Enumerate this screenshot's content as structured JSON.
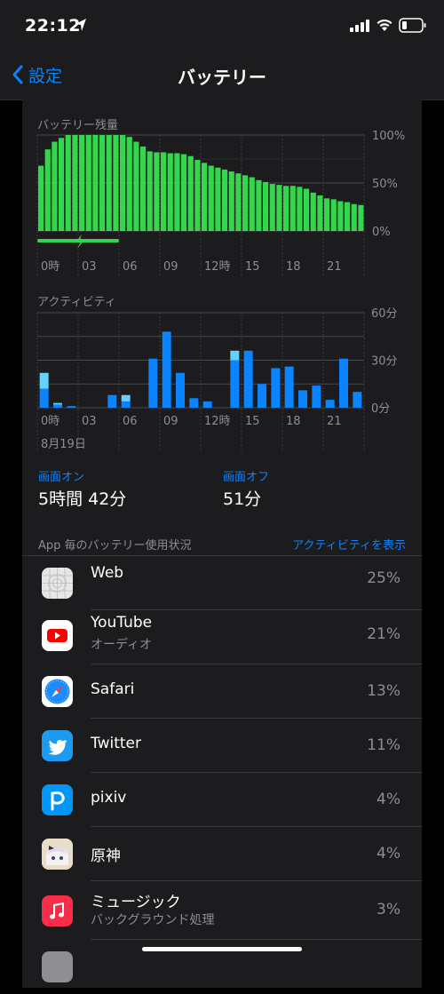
{
  "status": {
    "time": "22:12"
  },
  "nav": {
    "back_label": "設定",
    "title": "バッテリー"
  },
  "battery_chart": {
    "label": "バッテリー残量",
    "y_ticks": [
      "100%",
      "50%",
      "0%"
    ],
    "x_ticks": [
      "0時",
      "03",
      "06",
      "09",
      "12時",
      "15",
      "18",
      "21"
    ]
  },
  "activity_chart": {
    "label": "アクティビティ",
    "y_ticks": [
      "60分",
      "30分",
      "0分"
    ],
    "x_ticks": [
      "0時",
      "03",
      "06",
      "09",
      "12時",
      "15",
      "18",
      "21"
    ],
    "date_label": "8月19日"
  },
  "chart_data": [
    {
      "type": "area",
      "title": "バッテリー残量",
      "ylim": [
        0,
        100
      ],
      "x_unit": "hour",
      "x": [
        0,
        0.5,
        1,
        1.5,
        2,
        2.5,
        3,
        3.5,
        4,
        4.5,
        5,
        5.5,
        6,
        6.5,
        7,
        7.5,
        8,
        8.5,
        9,
        9.5,
        10,
        10.5,
        11,
        11.5,
        12,
        12.5,
        13,
        13.5,
        14,
        14.5,
        15,
        15.5,
        16,
        16.5,
        17,
        17.5,
        18,
        18.5,
        19,
        19.5,
        20,
        20.5,
        21,
        21.5
      ],
      "values": [
        68,
        85,
        93,
        97,
        100,
        100,
        100,
        100,
        100,
        100,
        100,
        100,
        100,
        98,
        93,
        88,
        83,
        82,
        82,
        81,
        81,
        80,
        78,
        74,
        71,
        68,
        66,
        64,
        62,
        60,
        58,
        56,
        53,
        51,
        49,
        48,
        47,
        47,
        46,
        44,
        40,
        37,
        34,
        33,
        31,
        30,
        28,
        27,
        27,
        26
      ],
      "charging_hours": [
        [
          0,
          6
        ]
      ]
    },
    {
      "type": "bar",
      "title": "アクティビティ",
      "ylim": [
        0,
        60
      ],
      "x_unit": "hour",
      "series": [
        {
          "name": "画面オン",
          "values": [
            12,
            2,
            1,
            0,
            0,
            8,
            4,
            0,
            31,
            48,
            22,
            6,
            4,
            0,
            30,
            36,
            15,
            25,
            26,
            11,
            14,
            5,
            31,
            10,
            5
          ]
        },
        {
          "name": "画面オフ",
          "values": [
            10,
            1,
            0,
            0,
            0,
            0,
            4,
            0,
            0,
            0,
            0,
            0,
            0,
            0,
            6,
            0,
            0,
            0,
            0,
            0,
            0,
            0,
            0,
            0,
            0
          ]
        }
      ],
      "x": [
        0.5,
        1.5,
        2.5,
        3.5,
        4.5,
        5.5,
        6.5,
        7.5,
        8.5,
        9.5,
        10.5,
        11.5,
        12.5,
        13.5,
        14.5,
        15.5,
        16.5,
        17.5,
        18.5,
        19.5,
        20.5,
        21.5,
        22.5,
        23.5,
        24.5
      ]
    }
  ],
  "screen_on": {
    "label": "画面オン",
    "value": "5時間 42分"
  },
  "screen_off": {
    "label": "画面オフ",
    "value": "51分"
  },
  "usage": {
    "header": "App 毎のバッテリー使用状況",
    "show_activity": "アクティビティを表示",
    "apps": [
      {
        "name": "Web",
        "sub": "",
        "pct": "25%",
        "icon": "web-icon"
      },
      {
        "name": "YouTube",
        "sub": "オーディオ",
        "pct": "21%",
        "icon": "youtube-icon"
      },
      {
        "name": "Safari",
        "sub": "",
        "pct": "13%",
        "icon": "safari-icon"
      },
      {
        "name": "Twitter",
        "sub": "",
        "pct": "11%",
        "icon": "twitter-icon"
      },
      {
        "name": "pixiv",
        "sub": "",
        "pct": "4%",
        "icon": "pixiv-icon"
      },
      {
        "name": "原神",
        "sub": "",
        "pct": "4%",
        "icon": "genshin-icon"
      },
      {
        "name": "ミュージック",
        "sub": "バックグラウンド処理",
        "pct": "3%",
        "icon": "music-icon"
      }
    ]
  }
}
